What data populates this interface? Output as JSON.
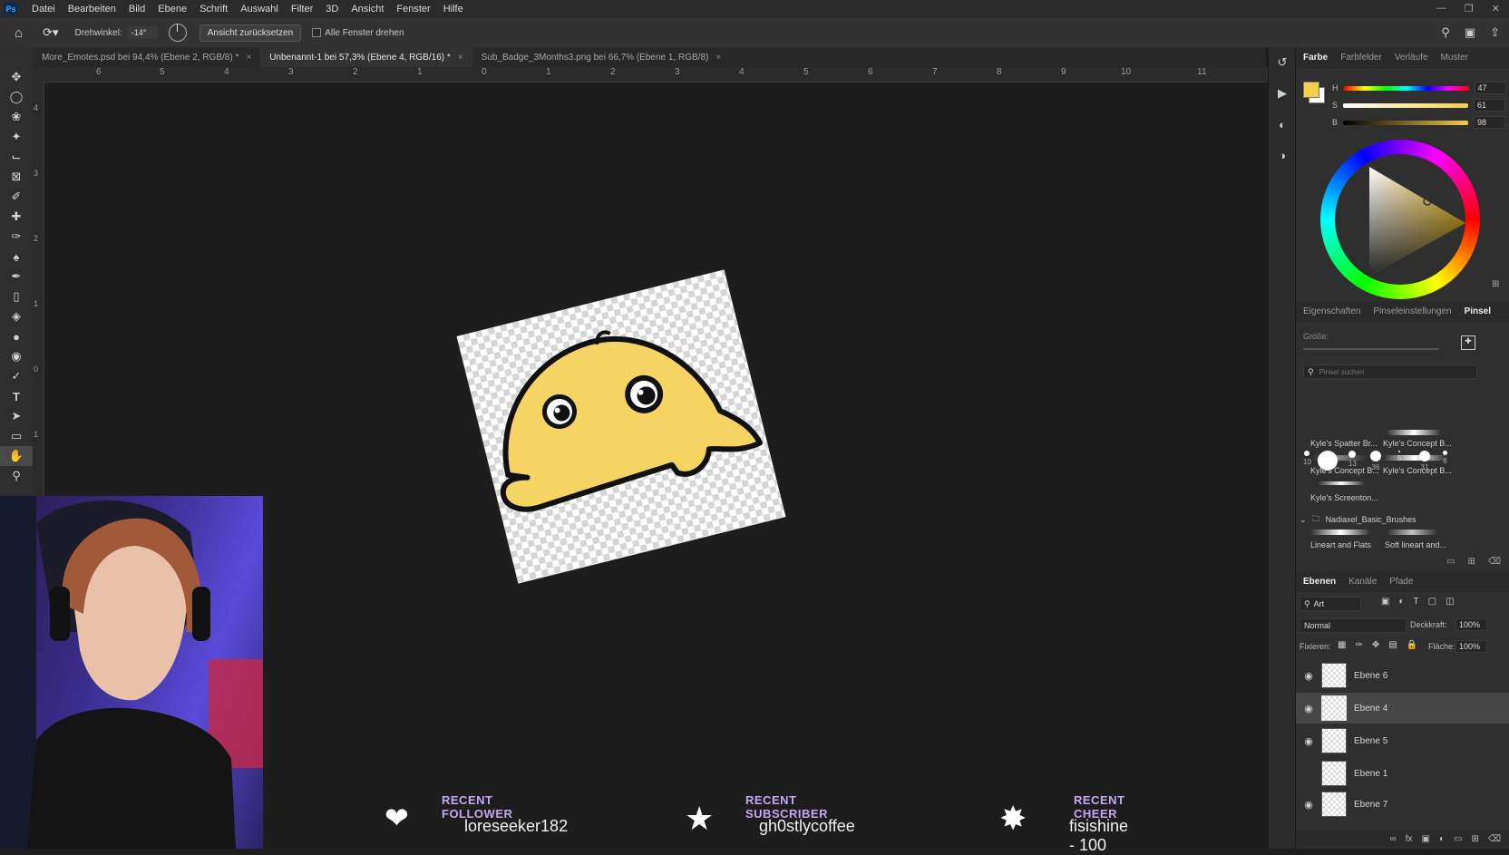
{
  "menu": {
    "logo": "Ps",
    "items": [
      "Datei",
      "Bearbeiten",
      "Bild",
      "Ebene",
      "Schrift",
      "Auswahl",
      "Filter",
      "3D",
      "Ansicht",
      "Fenster",
      "Hilfe"
    ]
  },
  "options": {
    "rotate_label": "Drehwinkel:",
    "rotate_value": "-14°",
    "reset_view": "Ansicht zurücksetzen",
    "rotate_all": "Alle Fenster drehen"
  },
  "tabs": [
    {
      "label": "More_Emotes.psd bei 94,4% (Ebene 2, RGB/8) *",
      "active": false
    },
    {
      "label": "Unbenannt-1 bei 57,3% (Ebene 4, RGB/16) *",
      "active": true
    },
    {
      "label": "Sub_Badge_3Months3.png bei 66,7% (Ebene 1, RGB/8)",
      "active": false
    }
  ],
  "ruler": {
    "top_labels": [
      "6",
      "5",
      "4",
      "3",
      "2",
      "1",
      "0",
      "1",
      "2",
      "3",
      "4",
      "5",
      "6",
      "7",
      "8",
      "9",
      "10",
      "11"
    ],
    "left_labels": [
      "4",
      "3",
      "2",
      "1",
      "0",
      "1"
    ]
  },
  "color_panel": {
    "tabs": [
      "Farbe",
      "Farbfelder",
      "Verläufe",
      "Muster"
    ],
    "h_label": "H",
    "h_value": "47",
    "h_unit": "°",
    "s_label": "S",
    "s_value": "61",
    "s_unit": "%",
    "b_label": "B",
    "b_value": "98",
    "b_unit": "%",
    "foreground": "#f4cf4a",
    "background": "#ffffff"
  },
  "brush_panel": {
    "tabs": [
      "Eigenschaften",
      "Pinseleinstellungen",
      "Pinsel"
    ],
    "size_label": "Größe:",
    "search_placeholder": "Pinsel suchen",
    "preset_sizes": [
      "10",
      "",
      "13",
      "36",
      "5",
      "31",
      "8"
    ],
    "brushes": [
      "Kyle's Spatter Br...",
      "Kyle's Concept B...",
      "Kyle's Concept B...",
      "Kyle's Concept B...",
      "Kyle's Screenton..."
    ],
    "group_name": "Nadiaxel_Basic_Brushes",
    "group_brushes": [
      "Lineart and Flats",
      "Soft lineart and..."
    ]
  },
  "layers_panel": {
    "tabs": [
      "Ebenen",
      "Kanäle",
      "Pfade"
    ],
    "filter_label": "Art",
    "blend_mode": "Normal",
    "opacity_label": "Deckkraft:",
    "opacity_value": "100%",
    "lock_label": "Fixieren:",
    "fill_label": "Fläche:",
    "fill_value": "100%",
    "layers": [
      {
        "name": "Ebene 6",
        "visible": true,
        "selected": false
      },
      {
        "name": "Ebene 4",
        "visible": true,
        "selected": true
      },
      {
        "name": "Ebene 5",
        "visible": true,
        "selected": false
      },
      {
        "name": "Ebene 1",
        "visible": false,
        "selected": false
      },
      {
        "name": "Ebene 7",
        "visible": true,
        "selected": false
      }
    ]
  },
  "overlay": {
    "follower_title": "RECENT FOLLOWER",
    "follower_name": "loreseeker182",
    "subscriber_title": "RECENT SUBSCRIBER",
    "subscriber_name": "gh0stlycoffee",
    "cheer_title": "RECENT CHEER",
    "cheer_name": "fisishine - 100"
  }
}
